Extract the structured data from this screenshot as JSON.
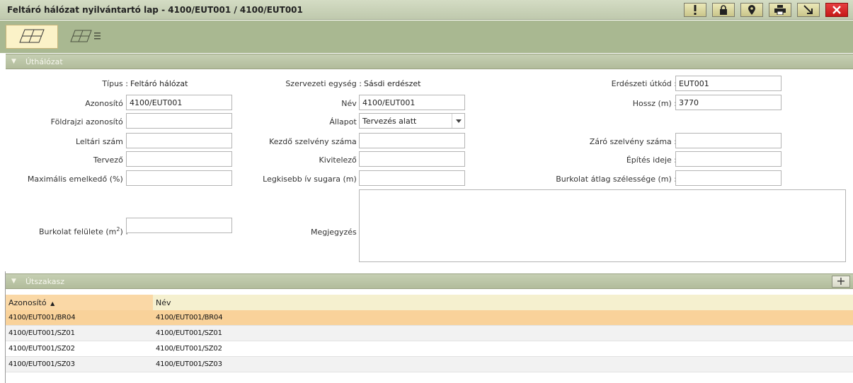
{
  "window": {
    "title": "Feltáró hálózat nyilvántartó lap - 4100/EUT001 / 4100/EUT001",
    "buttons": [
      {
        "icon": "exclamation-icon"
      },
      {
        "icon": "lock-icon"
      },
      {
        "icon": "map-pin-icon"
      },
      {
        "icon": "print-icon"
      },
      {
        "icon": "minimize-arrow-icon"
      },
      {
        "icon": "close-icon"
      }
    ]
  },
  "toolbar": {
    "views": [
      {
        "icon": "grid-view-icon",
        "active": true
      },
      {
        "icon": "grid-list-view-icon",
        "active": false
      }
    ]
  },
  "sections": {
    "uthalozat": "Úthálózat",
    "utszakasz": "Útszakasz"
  },
  "form": {
    "tipus": {
      "label": "Típus :",
      "value": "Feltáró hálózat"
    },
    "szervezeti_egyseg": {
      "label": "Szervezeti egység :",
      "value": "Sásdi erdészet"
    },
    "erdeszeti_utkod": {
      "label": "Erdészeti útkód :",
      "value": "EUT001"
    },
    "azonosito": {
      "label": "Azonosító :",
      "value": "4100/EUT001"
    },
    "nev": {
      "label": "Név :",
      "value": "4100/EUT001"
    },
    "hossz": {
      "label": "Hossz (m) :",
      "value": "3770"
    },
    "foldrajzi_azonosito": {
      "label": "Földrajzi azonosító :",
      "value": ""
    },
    "allapot": {
      "label": "Állapot :",
      "value": "Tervezés alatt"
    },
    "leltari_szam": {
      "label": "Leltári szám :",
      "value": ""
    },
    "kezdo_szelveny": {
      "label": "Kezdő szelvény száma :",
      "value": ""
    },
    "zaro_szelveny": {
      "label": "Záró szelvény száma :",
      "value": ""
    },
    "tervezo": {
      "label": "Tervező :",
      "value": ""
    },
    "kivitelezo": {
      "label": "Kivitelező :",
      "value": ""
    },
    "epites_ideje": {
      "label": "Építés ideje :",
      "value": ""
    },
    "max_emelkedo": {
      "label": "Maximális emelkedő (%) :",
      "value": ""
    },
    "legkisebb_iv": {
      "label": "Legkisebb ív sugara (m) :",
      "value": ""
    },
    "burkolat_atlag": {
      "label": "Burkolat átlag szélessége (m) :",
      "value": ""
    },
    "burkolat_felulete": {
      "label_pre": "Burkolat felülete (m",
      "label_sup": "2",
      "label_post": ") :",
      "value": ""
    },
    "megjegyzes": {
      "label": "Megjegyzés :",
      "value": ""
    }
  },
  "table": {
    "columns": [
      "Azonosító",
      "Név"
    ],
    "sort_indicator": "▲",
    "rows": [
      {
        "azonosito": "4100/EUT001/BR04",
        "nev": "4100/EUT001/BR04",
        "selected": true
      },
      {
        "azonosito": "4100/EUT001/SZ01",
        "nev": "4100/EUT001/SZ01",
        "selected": false
      },
      {
        "azonosito": "4100/EUT001/SZ02",
        "nev": "4100/EUT001/SZ02",
        "selected": false
      },
      {
        "azonosito": "4100/EUT001/SZ03",
        "nev": "4100/EUT001/SZ03",
        "selected": false
      }
    ],
    "add_label": "+"
  },
  "colors": {
    "selected_row": "#f9d29a",
    "section_header": "#b2bc9b",
    "close_button": "#d42020"
  }
}
